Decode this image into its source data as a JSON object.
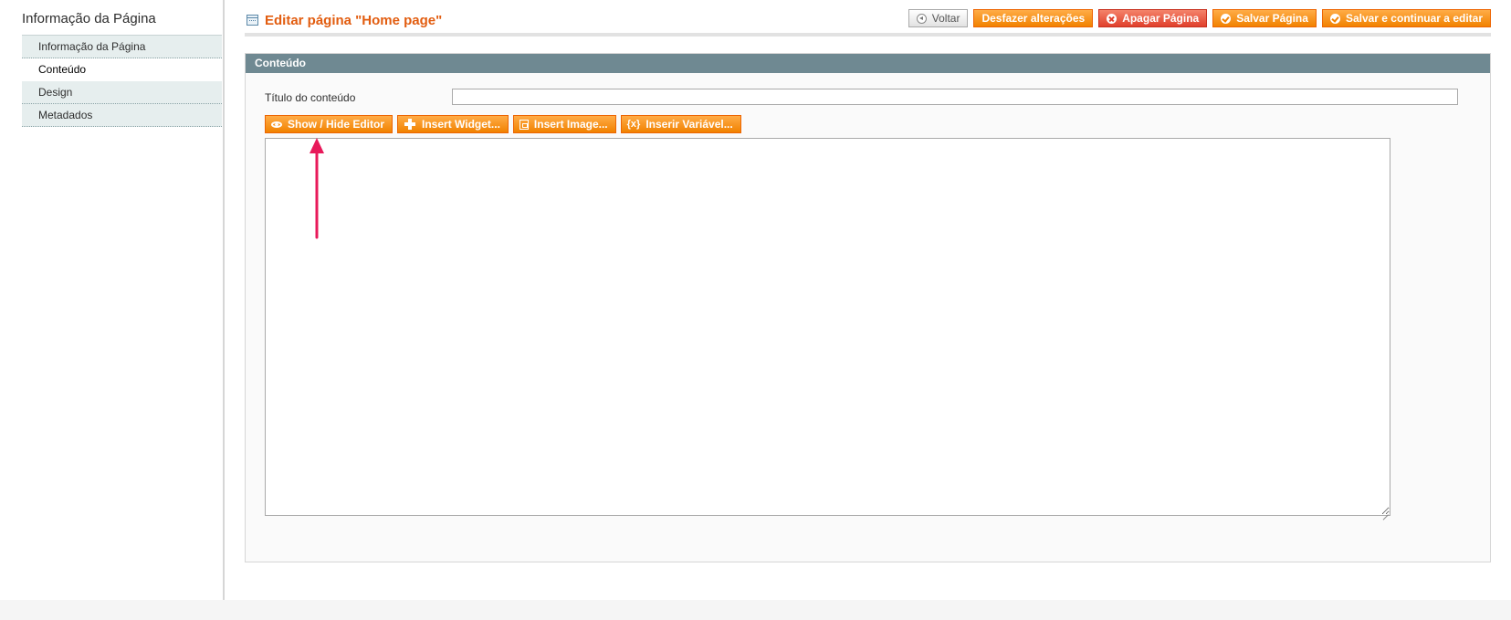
{
  "sidebar": {
    "title": "Informação da Página",
    "tabs": [
      {
        "label": "Informação da Página"
      },
      {
        "label": "Conteúdo"
      },
      {
        "label": "Design"
      },
      {
        "label": "Metadados"
      }
    ]
  },
  "header": {
    "title": "Editar página \"Home page\""
  },
  "actions": {
    "back": "Voltar",
    "reset": "Desfazer alterações",
    "delete": "Apagar Página",
    "save": "Salvar Página",
    "save_continue": "Salvar e continuar a editar"
  },
  "section": {
    "title": "Conteúdo",
    "field_label": "Título do conteúdo",
    "field_value": "",
    "editor_buttons": {
      "toggle": "Show / Hide Editor",
      "widget": "Insert Widget...",
      "image": "Insert Image...",
      "variable": "Inserir Variável..."
    },
    "content": ""
  },
  "colors": {
    "accent": "#f18200",
    "title": "#e25d10",
    "section_header": "#6f8992",
    "annotation": "#e8195a"
  }
}
